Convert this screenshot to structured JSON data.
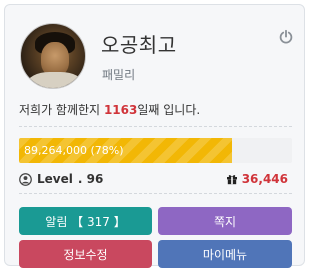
{
  "profile": {
    "username": "오공최고",
    "grade": "패밀리"
  },
  "together": {
    "prefix": "저희가 함께한지",
    "days": "1163",
    "suffix": "일째 입니다."
  },
  "experience": {
    "label": "89,264,000 (78%)",
    "percent": 78,
    "fill_color": "#f2b705"
  },
  "level": {
    "label": "Level",
    "value": ". 96"
  },
  "points": {
    "value": "36,446"
  },
  "buttons": {
    "alarm": "알림 【 317 】",
    "note": "쪽지",
    "info": "정보수정",
    "menu": "마이메뉴"
  },
  "icons": {
    "logout": "power-icon",
    "level": "user-icon",
    "points": "gift-icon"
  },
  "colors": {
    "alarm": "#1a9a94",
    "note": "#8e67c3",
    "info": "#c9485f",
    "menu": "#5075b8",
    "highlight": "#d0343a"
  }
}
